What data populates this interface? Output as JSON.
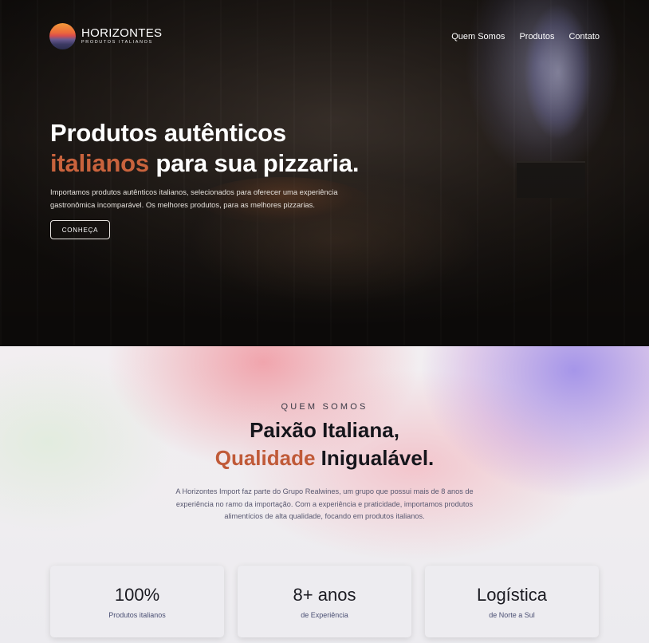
{
  "brand": {
    "title": "HORIZONTES",
    "subtitle": "PRODUTOS ITALIANOS",
    "accent_color": "#c9633d"
  },
  "nav": {
    "items": [
      "Quem Somos",
      "Produtos",
      "Contato"
    ]
  },
  "hero": {
    "title_line1": "Produtos autênticos",
    "title_accent": "italianos",
    "title_rest": " para sua pizzaria.",
    "description": "Importamos produtos autênticos italianos, selecionados para oferecer uma experiência gastronômica incomparável. Os melhores produtos, para as melhores pizzarias.",
    "button_label": "CONHEÇA"
  },
  "about": {
    "kicker": "QUEM SOMOS",
    "title_line1": "Paixão Italiana,",
    "title_accent": "Qualidade",
    "title_rest": " Inigualável.",
    "description": "A Horizontes Import faz parte do Grupo Realwines, um grupo que possui mais de 8 anos de experiência no ramo da importação. Com a experiência e praticidade, importamos produtos alimentícios de alta qualidade, focando em produtos italianos."
  },
  "stats": [
    {
      "value": "100%",
      "label": "Produtos italianos"
    },
    {
      "value": "8+ anos",
      "label": "de Experiência"
    },
    {
      "value": "Logística",
      "label": "de Norte a Sul"
    }
  ]
}
